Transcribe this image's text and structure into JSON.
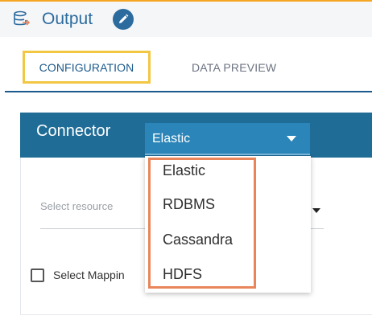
{
  "header": {
    "title": "Output",
    "icon": "database-export-icon",
    "edit_icon": "pencil-icon"
  },
  "tabs": [
    {
      "label": "CONFIGURATION",
      "active": true
    },
    {
      "label": "DATA PREVIEW",
      "active": false
    }
  ],
  "connector": {
    "label": "Connector",
    "selected": "Elastic",
    "options": [
      "Elastic",
      "RDBMS",
      "Cassandra",
      "HDFS"
    ]
  },
  "resource": {
    "placeholder": "Select resource"
  },
  "mapping": {
    "label": "Select Mappin",
    "checked": false
  },
  "colors": {
    "accent": "#1f6c96",
    "tab_highlight": "#f2c744",
    "menu_highlight": "#e8855a",
    "title": "#2c6b9e"
  }
}
